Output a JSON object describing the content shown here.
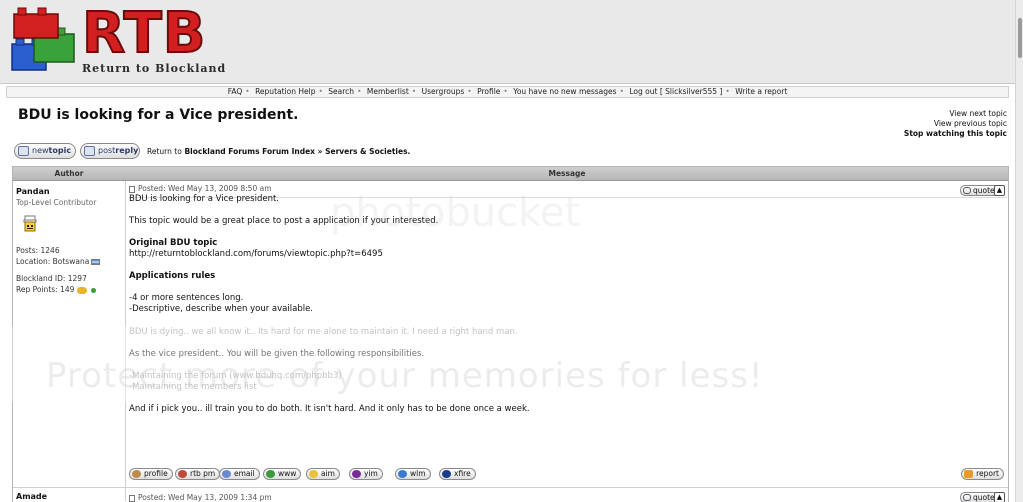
{
  "header": {
    "logo_text": "RTB",
    "logo_subtitle": "Return to Blockland"
  },
  "nav": {
    "items": [
      "FAQ",
      "Reputation Help",
      "Search",
      "Memberlist",
      "Usergroups",
      "Profile",
      "You have no new messages",
      "Log out [ Slicksilver555 ]",
      "Write a report"
    ]
  },
  "topic": {
    "title": "BDU is looking for a Vice president.",
    "links": {
      "next": "View next topic",
      "previous": "View previous topic",
      "stop_watching": "Stop watching this topic"
    }
  },
  "buttons": {
    "new_topic": {
      "prefix": "new",
      "bold": "topic"
    },
    "post_reply": {
      "prefix": "post",
      "bold": "reply"
    }
  },
  "breadcrumb": {
    "prefix": "Return to",
    "path": "Blockland Forums Forum Index » Servers & Societies."
  },
  "table": {
    "author_header": "Author",
    "message_header": "Message"
  },
  "post1": {
    "author": "Pandan",
    "rank": "Top-Level Contributor",
    "posts": "Posts: 1246",
    "location": "Location: Botswana",
    "blockland_id": "Blockland ID: 1297",
    "rep_points": "Rep Points: 149",
    "posted": "Posted: Wed May 13, 2009 8:50 am",
    "quote_label": "quote",
    "body": {
      "p1": "BDU is looking for a Vice president.",
      "p2": "This topic would be a great place to post a application if your interested.",
      "original_label": "Original BDU topic",
      "original_url": "http://returntoblockland.com/forums/viewtopic.php?t=6495",
      "rules_label": "Applications rules",
      "rule1": "-4 or more sentences long.",
      "rule2": "-Descriptive, describe when your available.",
      "p3": "BDU is dying.. we all know it.. Its hard for me alone to maintain it. I need a right hand man.",
      "p4": "As the vice president.. You will be given the following responsibilities.",
      "resp1": "-Maintaining the forum (www.bduhq.com/phpbb3)",
      "resp2": "-Maintaining the members list",
      "p5": "And if i pick you.. ill train you to do both. It isn't hard. And it only has to be done once a week."
    },
    "contacts": [
      "profile",
      "rtb pm",
      "email",
      "www",
      "aim",
      "yim",
      "wlm",
      "xfire"
    ],
    "report_label": "report"
  },
  "post2": {
    "author": "Amade",
    "posted": "Posted: Wed May 13, 2009 1:34 pm",
    "quote_label": "quote"
  },
  "watermark": {
    "logo": "photobucket",
    "tagline": "Protect more of your memories for less!"
  },
  "colors": {
    "logo_red": "#d22020",
    "header_bg": "#e9e9e9",
    "table_header": "#c4c4c4"
  }
}
